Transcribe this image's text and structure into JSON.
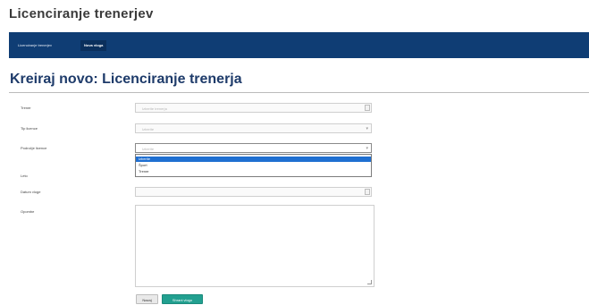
{
  "app": {
    "title": "Licenciranje trenerjev"
  },
  "nav": {
    "items": [
      "Licenciranje trenerjev",
      "Nova vloga"
    ]
  },
  "page": {
    "title": "Kreiraj novo: Licenciranje trenerja"
  },
  "form": {
    "fields": [
      {
        "label": "Trener",
        "placeholder": "Izberite trenerja"
      },
      {
        "label": "Tip licence",
        "placeholder": "Izberite"
      },
      {
        "label": "Področje licence",
        "placeholder": "Izberite"
      },
      {
        "label": "Leto",
        "placeholder": ""
      },
      {
        "label": "Datum vloge",
        "placeholder": ""
      },
      {
        "label": "Opombe",
        "placeholder": ""
      }
    ],
    "dropdown_options": [
      "Izberite",
      "Šport",
      "Trener"
    ]
  },
  "buttons": {
    "back": "Nazaj",
    "save": "Shrani vlogo"
  },
  "colors": {
    "navbar": "#0f3d74",
    "title": "#1e3b6a",
    "save": "#22a090",
    "selection": "#1f6fd1"
  }
}
